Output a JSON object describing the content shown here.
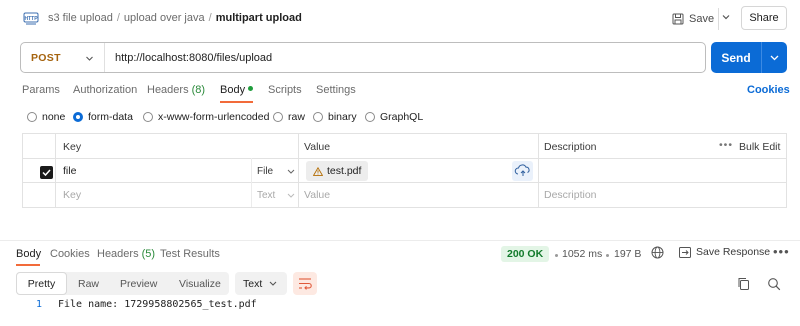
{
  "header": {
    "app_icon": "http-icon",
    "breadcrumb": [
      "s3 file upload",
      "upload over java",
      "multipart upload"
    ],
    "save_label": "Save",
    "share_label": "Share"
  },
  "request": {
    "method": "POST",
    "url": "http://localhost:8080/files/upload",
    "send_label": "Send"
  },
  "request_tabs": {
    "params": "Params",
    "authorization": "Authorization",
    "headers": "Headers",
    "headers_count": "(8)",
    "body": "Body",
    "scripts": "Scripts",
    "settings": "Settings",
    "cookies": "Cookies",
    "active": "Body"
  },
  "body_types": {
    "options": [
      "none",
      "form-data",
      "x-www-form-urlencoded",
      "raw",
      "binary",
      "GraphQL"
    ],
    "selected": "form-data"
  },
  "form_table": {
    "headers": {
      "key": "Key",
      "value": "Value",
      "description": "Description",
      "bulk_edit": "Bulk Edit"
    },
    "rows": [
      {
        "checked": true,
        "key": "file",
        "type": "File",
        "value": "test.pdf",
        "description": ""
      }
    ],
    "placeholder": {
      "key": "Key",
      "type": "Text",
      "value": "Value",
      "description": "Description"
    }
  },
  "response": {
    "tabs": {
      "body": "Body",
      "cookies": "Cookies",
      "headers": "Headers",
      "headers_count": "(5)",
      "test_results": "Test Results",
      "active": "Body"
    },
    "status": "200 OK",
    "time": "1052 ms",
    "size": "197 B",
    "save_response": "Save Response",
    "view_modes": [
      "Pretty",
      "Raw",
      "Preview",
      "Visualize"
    ],
    "active_view": "Pretty",
    "format": "Text",
    "lines": [
      {
        "num": "1",
        "text": "File name: 1729958802565_test.pdf"
      }
    ]
  },
  "colors": {
    "accent_blue": "#0b6bd6",
    "method_orange": "#a5630e",
    "tab_underline": "#f26b3a",
    "status_green": "#127a2b"
  }
}
